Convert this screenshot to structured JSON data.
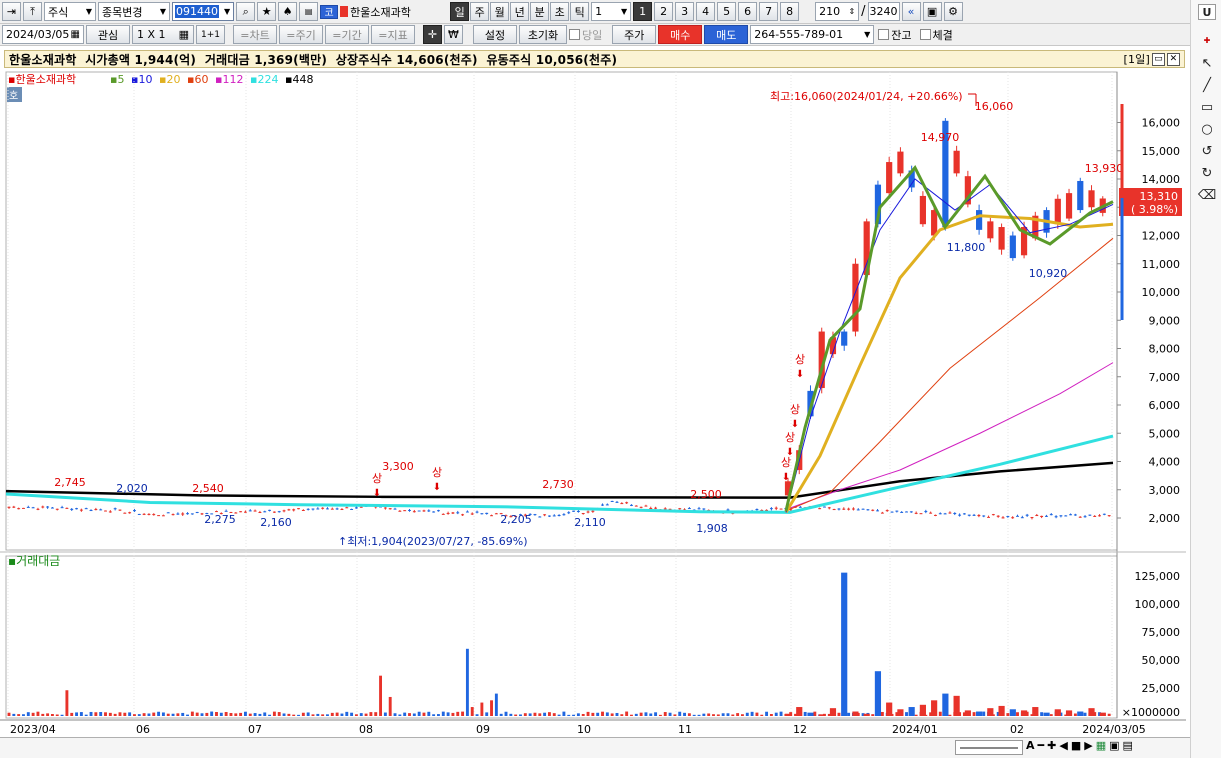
{
  "toolbar_top": {
    "market": "주식",
    "change_label": "종목변경",
    "code": "091440",
    "exchange_badge": "코",
    "stock_name": "한울소재과학",
    "periods": [
      "일",
      "주",
      "월",
      "년",
      "분",
      "초",
      "틱"
    ],
    "interval_value": "1",
    "quick_numbers": [
      "1",
      "2",
      "3",
      "4",
      "5",
      "6",
      "7",
      "8"
    ],
    "bar_count": "210",
    "bar_total": "3240",
    "u_label": "U"
  },
  "toolbar_second": {
    "date": "2024/03/05",
    "watch_label": "관심",
    "layout_label": "1 X 1",
    "one_plus_label": "1+1",
    "chart_tab": "=차트",
    "cycle_tab": "=주기",
    "range_tab": "=기간",
    "indicator_tab": "=지표",
    "won_label": "₩",
    "settings_label": "설정",
    "reset_label": "초기화",
    "sameday_label": "당일",
    "price_label": "주가",
    "buy_label": "매수",
    "sell_label": "매도",
    "account": "264-555-789-01",
    "balance_label": "잔고",
    "fill_label": "체결"
  },
  "info_bar": {
    "text": "한울소재과학  시가총액 1,944(억)  거래대금 1,369(백만)  상장주식수 14,606(천주)  유동주식 10,056(천주)",
    "period_label": "[1일]"
  },
  "legend": {
    "name": "한울소재과학",
    "ma": [
      {
        "label": "5",
        "color": "#5a9a2a"
      },
      {
        "label": "10",
        "color": "#1a1adc"
      },
      {
        "label": "20",
        "color": "#e0b020"
      },
      {
        "label": "60",
        "color": "#e04010"
      },
      {
        "label": "112",
        "color": "#d020c0"
      },
      {
        "label": "224",
        "color": "#30e0e0"
      },
      {
        "label": "448",
        "color": "#000000"
      }
    ],
    "ho_badge": "호"
  },
  "volume_legend": "거래대금",
  "colors": {
    "up": "#e8332a",
    "down": "#1f66e0"
  },
  "annotations": {
    "high": "최고:16,060(2024/01/24, +20.66%)",
    "low": "최저:1,904(2023/07/27, -85.69%)",
    "limit_up": "상",
    "current_price": "13,310",
    "current_pct": "( 3.98%)",
    "vol_unit": "×1000000"
  },
  "chart_data": {
    "type": "candlestick",
    "date_range": [
      "2023/04",
      "2024/03/05"
    ],
    "x_tick_labels": [
      "2023/04",
      "06",
      "07",
      "08",
      "09",
      "10",
      "11",
      "12",
      "2024/01",
      "02",
      "2024/03/05"
    ],
    "price_ticks": [
      "2,000",
      "3,000",
      "4,000",
      "5,000",
      "6,000",
      "7,000",
      "8,000",
      "9,000",
      "10,000",
      "11,000",
      "12,000",
      "13,000",
      "14,000",
      "15,000",
      "16,000"
    ],
    "volume_ticks": [
      "25,000",
      "50,000",
      "75,000",
      "100,000",
      "125,000"
    ],
    "point_labels": [
      {
        "label": "2,745",
        "value": 2745,
        "kind": "high"
      },
      {
        "label": "2,020",
        "value": 2020,
        "kind": "low"
      },
      {
        "label": "2,540",
        "value": 2540,
        "kind": "high"
      },
      {
        "label": "2,540",
        "value": 2540,
        "kind": "high"
      },
      {
        "label": "2,275",
        "value": 2275,
        "kind": "low"
      },
      {
        "label": "2,160",
        "value": 2160,
        "kind": "low"
      },
      {
        "label": "3,300",
        "value": 3300,
        "kind": "high"
      },
      {
        "label": "2,205",
        "value": 2205,
        "kind": "low"
      },
      {
        "label": "2,730",
        "value": 2730,
        "kind": "high"
      },
      {
        "label": "2,110",
        "value": 2110,
        "kind": "low"
      },
      {
        "label": "2,500",
        "value": 2500,
        "kind": "high"
      },
      {
        "label": "1,908",
        "value": 1908,
        "kind": "low"
      },
      {
        "label": "14,970",
        "value": 14970,
        "kind": "high"
      },
      {
        "label": "16,060",
        "value": 16060,
        "kind": "high"
      },
      {
        "label": "11,800",
        "value": 11800,
        "kind": "low"
      },
      {
        "label": "10,920",
        "value": 10920,
        "kind": "low"
      },
      {
        "label": "13,930",
        "value": 13930,
        "kind": "high"
      }
    ],
    "ma_lines_last": {
      "5": 13200,
      "10": 12900,
      "20": 12400,
      "60": 11900,
      "112": 7500,
      "224": 4900,
      "448": 3950
    }
  }
}
